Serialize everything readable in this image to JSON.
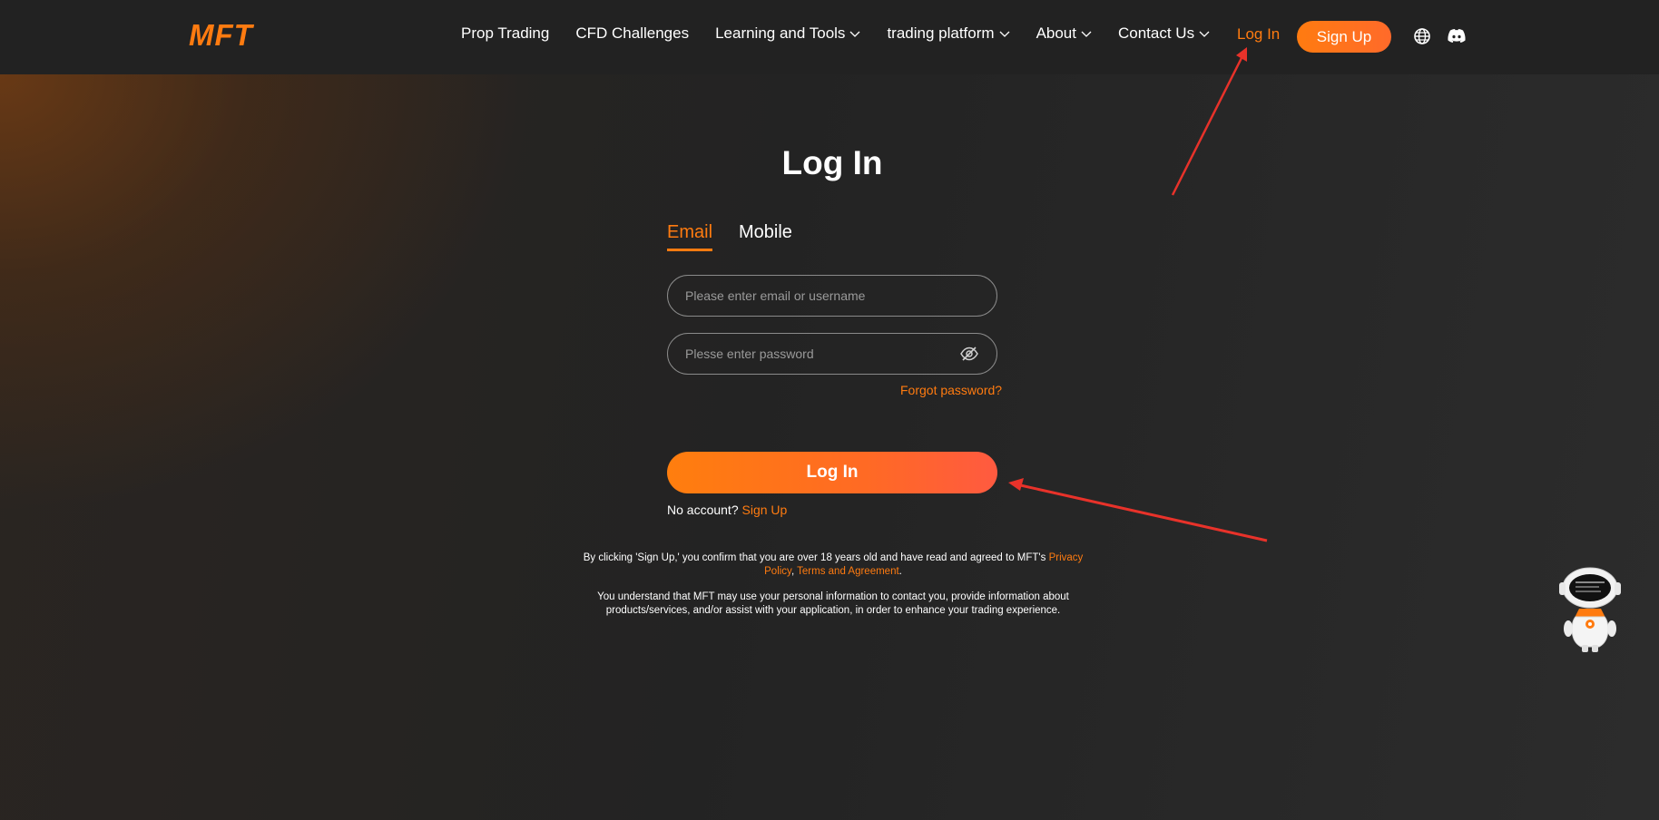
{
  "header": {
    "logo": "MFT",
    "nav": [
      {
        "label": "Prop Trading",
        "dropdown": false
      },
      {
        "label": "CFD Challenges",
        "dropdown": false
      },
      {
        "label": "Learning and Tools",
        "dropdown": true
      },
      {
        "label": "trading platform",
        "dropdown": true
      },
      {
        "label": "About",
        "dropdown": true
      },
      {
        "label": "Contact Us",
        "dropdown": true
      }
    ],
    "login_label": "Log In",
    "signup_label": "Sign Up",
    "icons": [
      "globe-icon",
      "discord-icon"
    ]
  },
  "form": {
    "title": "Log In",
    "tabs": [
      {
        "label": "Email",
        "active": true
      },
      {
        "label": "Mobile",
        "active": false
      }
    ],
    "email_placeholder": "Please enter email or username",
    "password_placeholder": "Plesse enter password",
    "forgot_label": "Forgot password?",
    "submit_label": "Log In",
    "no_account_text": "No account?",
    "signup_link": "Sign Up"
  },
  "legal": {
    "p1_text": "By clicking 'Sign Up,' you confirm that you are over 18 years old and have read and agreed to MFT's",
    "privacy_link": "Privacy Policy",
    "separator": ",",
    "terms_link": "Terms and Agreement",
    "end": ".",
    "p2_text": "You understand that MFT may use your personal information to contact you, provide information about products/services, and/or assist with your application, in order to enhance your trading experience."
  },
  "colors": {
    "accent": "#ff7b10",
    "header_bg": "#222222",
    "annotation_arrow": "#e8322a"
  }
}
